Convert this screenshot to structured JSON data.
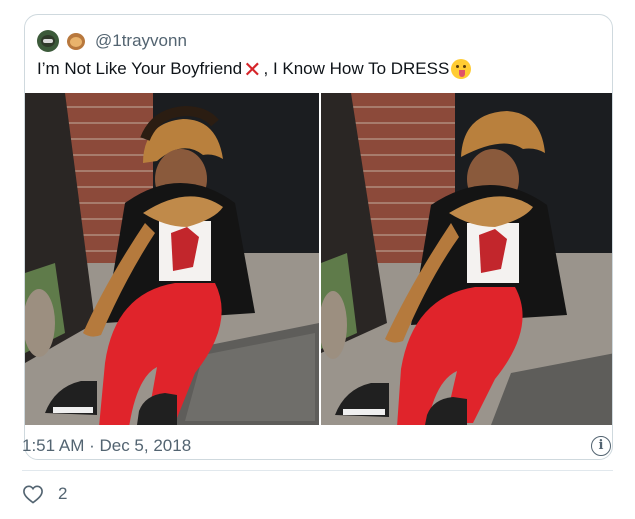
{
  "tweet": {
    "handle": "@1trayvonn",
    "text_part1": "I’m Not Like Your Boyfriend",
    "text_part2": ", I Know How To DRESS",
    "cross_mark": "❌",
    "avatar_icons": [
      "man-face-emoji-icon",
      "see-no-evil-monkey-icon"
    ],
    "trailing_emoji": "winking-face-with-tongue-icon"
  },
  "media": {
    "photos": [
      {
        "name": "photo-left"
      },
      {
        "name": "photo-right"
      }
    ]
  },
  "footer": {
    "timestamp": "1:51 AM · Dec 5, 2018",
    "info_icon_glyph": "i",
    "like_count": "2"
  },
  "colors": {
    "secondary_text": "#536471",
    "cross_red": "#d6252a",
    "border": "#cfd9de"
  }
}
